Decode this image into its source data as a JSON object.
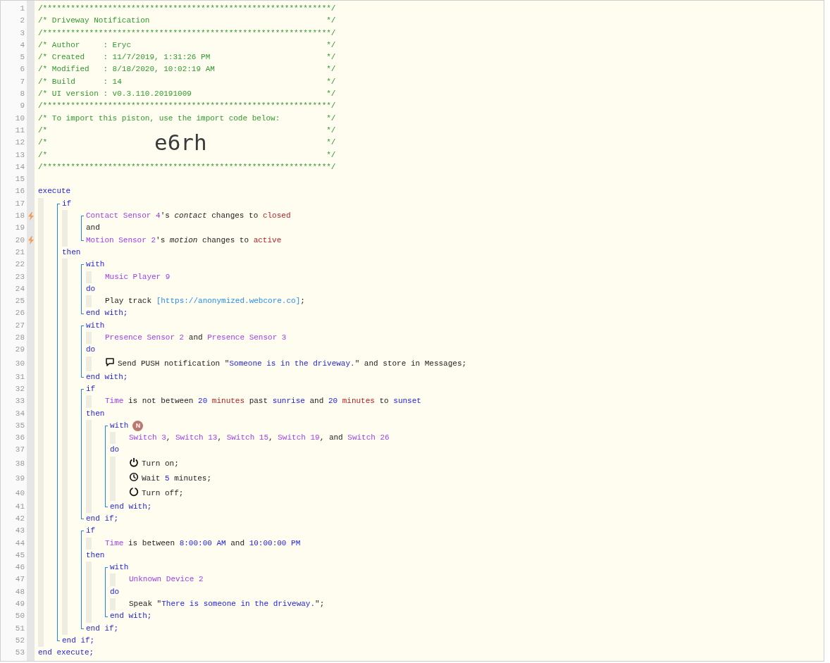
{
  "code": [
    {
      "kind": "line",
      "number": "1",
      "trigger": false,
      "segments": [
        {
          "kind": "comment",
          "text": "/**************************************************************/"
        }
      ]
    },
    {
      "kind": "line",
      "number": "2",
      "trigger": false,
      "segments": [
        {
          "kind": "comment_body",
          "text": "/* Driveway Notification"
        },
        {
          "kind": "comment",
          "text": "*/"
        }
      ]
    },
    {
      "kind": "line",
      "number": "3",
      "trigger": false,
      "segments": [
        {
          "kind": "comment",
          "text": "/**************************************************************/"
        }
      ]
    },
    {
      "kind": "line",
      "number": "4",
      "trigger": false,
      "segments": [
        {
          "kind": "comment_body",
          "text": "/* Author     : Eryc"
        },
        {
          "kind": "comment",
          "text": "*/"
        }
      ]
    },
    {
      "kind": "line",
      "number": "5",
      "trigger": false,
      "segments": [
        {
          "kind": "comment_body",
          "text": "/* Created    : 11/7/2019, 1:31:26 PM"
        },
        {
          "kind": "comment",
          "text": "*/"
        }
      ]
    },
    {
      "kind": "line",
      "number": "6",
      "trigger": false,
      "segments": [
        {
          "kind": "comment_body",
          "text": "/* Modified   : 8/18/2020, 10:02:19 AM"
        },
        {
          "kind": "comment",
          "text": "*/"
        }
      ]
    },
    {
      "kind": "line",
      "number": "7",
      "trigger": false,
      "segments": [
        {
          "kind": "comment_body",
          "text": "/* Build      : 14"
        },
        {
          "kind": "comment",
          "text": "*/"
        }
      ]
    },
    {
      "kind": "line",
      "number": "8",
      "trigger": false,
      "segments": [
        {
          "kind": "comment_body",
          "text": "/* UI version : v0.3.110.20191009"
        },
        {
          "kind": "comment",
          "text": "*/"
        }
      ]
    },
    {
      "kind": "line",
      "number": "9",
      "trigger": false,
      "segments": [
        {
          "kind": "comment",
          "text": "/**************************************************************/"
        }
      ]
    },
    {
      "kind": "line",
      "number": "10",
      "trigger": false,
      "segments": [
        {
          "kind": "comment_body",
          "text": "/* To import this piston, use the import code below:"
        },
        {
          "kind": "comment",
          "text": "*/"
        }
      ]
    },
    {
      "kind": "line",
      "number": "11",
      "trigger": false,
      "segments": [
        {
          "kind": "comment_body",
          "text": "/*"
        },
        {
          "kind": "comment",
          "text": "*/"
        }
      ]
    },
    {
      "kind": "line",
      "number": "12",
      "trigger": false,
      "segments": [
        {
          "kind": "comment_body",
          "text": "/*"
        },
        {
          "kind": "import_code",
          "text": "e6rh"
        },
        {
          "kind": "comment",
          "text": "*/"
        }
      ]
    },
    {
      "kind": "line",
      "number": "13",
      "trigger": false,
      "segments": [
        {
          "kind": "comment_body",
          "text": "/*"
        },
        {
          "kind": "comment",
          "text": "*/"
        }
      ]
    },
    {
      "kind": "line",
      "number": "14",
      "trigger": false,
      "segments": [
        {
          "kind": "comment",
          "text": "/**************************************************************/"
        }
      ]
    },
    {
      "kind": "line",
      "number": "15",
      "trigger": false
    },
    {
      "kind": "line",
      "number": "16",
      "trigger": false,
      "segments": [
        {
          "kind": "keyword",
          "text": "execute"
        }
      ]
    },
    {
      "kind": "indent",
      "children": [
        {
          "kind": "bracket",
          "children": [
            {
              "kind": "line",
              "number": "17",
              "trigger": false,
              "segments": [
                {
                  "kind": "keyword",
                  "text": "if"
                }
              ]
            },
            {
              "kind": "indent",
              "children": [
                {
                  "kind": "bracket",
                  "children": [
                    {
                      "kind": "line",
                      "number": "18",
                      "trigger": true,
                      "segments": [
                        {
                          "kind": "device",
                          "text": "Contact Sensor 4"
                        },
                        {
                          "kind": "plain",
                          "text": "'s "
                        },
                        {
                          "kind": "attribute",
                          "text": "contact"
                        },
                        {
                          "kind": "plain",
                          "text": " changes to "
                        },
                        {
                          "kind": "value",
                          "text": "closed"
                        }
                      ]
                    },
                    {
                      "kind": "line",
                      "number": "19",
                      "trigger": false,
                      "segments": [
                        {
                          "kind": "plain",
                          "text": "and"
                        }
                      ]
                    },
                    {
                      "kind": "line",
                      "number": "20",
                      "trigger": true,
                      "segments": [
                        {
                          "kind": "device",
                          "text": "Motion Sensor 2"
                        },
                        {
                          "kind": "plain",
                          "text": "'s "
                        },
                        {
                          "kind": "attribute",
                          "text": "motion"
                        },
                        {
                          "kind": "plain",
                          "text": " changes to "
                        },
                        {
                          "kind": "value",
                          "text": "active"
                        }
                      ]
                    }
                  ]
                }
              ]
            },
            {
              "kind": "line",
              "number": "21",
              "trigger": false,
              "segments": [
                {
                  "kind": "keyword",
                  "text": "then"
                }
              ]
            },
            {
              "kind": "indent",
              "children": [
                {
                  "kind": "bracket",
                  "children": [
                    {
                      "kind": "line",
                      "number": "22",
                      "trigger": false,
                      "segments": [
                        {
                          "kind": "keyword",
                          "text": "with"
                        }
                      ]
                    },
                    {
                      "kind": "indent",
                      "children": [
                        {
                          "kind": "line",
                          "number": "23",
                          "trigger": false,
                          "segments": [
                            {
                              "kind": "device",
                              "text": "Music Player 9"
                            }
                          ]
                        }
                      ]
                    },
                    {
                      "kind": "line",
                      "number": "24",
                      "trigger": false,
                      "segments": [
                        {
                          "kind": "keyword",
                          "text": "do"
                        }
                      ]
                    },
                    {
                      "kind": "indent",
                      "children": [
                        {
                          "kind": "line",
                          "number": "25",
                          "trigger": false,
                          "segments": [
                            {
                              "kind": "plain",
                              "text": "Play track "
                            },
                            {
                              "kind": "url",
                              "text": "[https://anonymized.webcore.co]"
                            },
                            {
                              "kind": "plain",
                              "text": ";"
                            }
                          ]
                        }
                      ]
                    },
                    {
                      "kind": "line",
                      "number": "26",
                      "trigger": false,
                      "segments": [
                        {
                          "kind": "keyword",
                          "text": "end with;"
                        }
                      ]
                    }
                  ]
                },
                {
                  "kind": "bracket",
                  "children": [
                    {
                      "kind": "line",
                      "number": "27",
                      "trigger": false,
                      "segments": [
                        {
                          "kind": "keyword",
                          "text": "with"
                        }
                      ]
                    },
                    {
                      "kind": "indent",
                      "children": [
                        {
                          "kind": "line",
                          "number": "28",
                          "trigger": false,
                          "segments": [
                            {
                              "kind": "device",
                              "text": "Presence Sensor 2"
                            },
                            {
                              "kind": "plain",
                              "text": " and "
                            },
                            {
                              "kind": "device",
                              "text": "Presence Sensor 3"
                            }
                          ]
                        }
                      ]
                    },
                    {
                      "kind": "line",
                      "number": "29",
                      "trigger": false,
                      "segments": [
                        {
                          "kind": "keyword",
                          "text": "do"
                        }
                      ]
                    },
                    {
                      "kind": "indent",
                      "children": [
                        {
                          "kind": "line",
                          "number": "30",
                          "trigger": false,
                          "segments": [
                            {
                              "kind": "chat"
                            },
                            {
                              "kind": "plain",
                              "text": "Send PUSH notification \""
                            },
                            {
                              "kind": "string",
                              "text": "Someone is in the driveway."
                            },
                            {
                              "kind": "plain",
                              "text": "\" and store in Messages;"
                            }
                          ]
                        }
                      ]
                    },
                    {
                      "kind": "line",
                      "number": "31",
                      "trigger": false,
                      "segments": [
                        {
                          "kind": "keyword",
                          "text": "end with;"
                        }
                      ]
                    }
                  ]
                },
                {
                  "kind": "bracket",
                  "children": [
                    {
                      "kind": "line",
                      "number": "32",
                      "trigger": false,
                      "segments": [
                        {
                          "kind": "keyword",
                          "text": "if"
                        }
                      ]
                    },
                    {
                      "kind": "indent",
                      "children": [
                        {
                          "kind": "line",
                          "number": "33",
                          "trigger": false,
                          "segments": [
                            {
                              "kind": "device",
                              "text": "Time"
                            },
                            {
                              "kind": "plain",
                              "text": " is not between "
                            },
                            {
                              "kind": "number",
                              "text": "20"
                            },
                            {
                              "kind": "value",
                              "text": " minutes"
                            },
                            {
                              "kind": "plain",
                              "text": " past "
                            },
                            {
                              "kind": "number",
                              "text": "sunrise"
                            },
                            {
                              "kind": "plain",
                              "text": " and "
                            },
                            {
                              "kind": "number",
                              "text": "20"
                            },
                            {
                              "kind": "value",
                              "text": " minutes"
                            },
                            {
                              "kind": "plain",
                              "text": " to "
                            },
                            {
                              "kind": "number",
                              "text": "sunset"
                            }
                          ]
                        }
                      ]
                    },
                    {
                      "kind": "line",
                      "number": "34",
                      "trigger": false,
                      "segments": [
                        {
                          "kind": "keyword",
                          "text": "then"
                        }
                      ]
                    },
                    {
                      "kind": "indent",
                      "children": [
                        {
                          "kind": "bracket",
                          "children": [
                            {
                              "kind": "line",
                              "number": "35",
                              "trigger": false,
                              "segments": [
                                {
                                  "kind": "keyword",
                                  "text": "with"
                                },
                                {
                                  "kind": "badge",
                                  "text": "N"
                                }
                              ]
                            },
                            {
                              "kind": "indent",
                              "children": [
                                {
                                  "kind": "line",
                                  "number": "36",
                                  "trigger": false,
                                  "segments": [
                                    {
                                      "kind": "device",
                                      "text": "Switch 3"
                                    },
                                    {
                                      "kind": "plain",
                                      "text": ", "
                                    },
                                    {
                                      "kind": "device",
                                      "text": "Switch 13"
                                    },
                                    {
                                      "kind": "plain",
                                      "text": ", "
                                    },
                                    {
                                      "kind": "device",
                                      "text": "Switch 15"
                                    },
                                    {
                                      "kind": "plain",
                                      "text": ", "
                                    },
                                    {
                                      "kind": "device",
                                      "text": "Switch 19"
                                    },
                                    {
                                      "kind": "plain",
                                      "text": ", and "
                                    },
                                    {
                                      "kind": "device",
                                      "text": "Switch 26"
                                    }
                                  ]
                                }
                              ]
                            },
                            {
                              "kind": "line",
                              "number": "37",
                              "trigger": false,
                              "segments": [
                                {
                                  "kind": "keyword",
                                  "text": "do"
                                }
                              ]
                            },
                            {
                              "kind": "indent",
                              "children": [
                                {
                                  "kind": "line",
                                  "number": "38",
                                  "trigger": false,
                                  "segments": [
                                    {
                                      "kind": "power"
                                    },
                                    {
                                      "kind": "plain",
                                      "text": "Turn on;"
                                    }
                                  ]
                                },
                                {
                                  "kind": "line",
                                  "number": "39",
                                  "trigger": false,
                                  "segments": [
                                    {
                                      "kind": "clock"
                                    },
                                    {
                                      "kind": "plain",
                                      "text": "Wait "
                                    },
                                    {
                                      "kind": "number",
                                      "text": "5"
                                    },
                                    {
                                      "kind": "plain",
                                      "text": " minutes;"
                                    }
                                  ]
                                },
                                {
                                  "kind": "line",
                                  "number": "40",
                                  "trigger": false,
                                  "segments": [
                                    {
                                      "kind": "ring"
                                    },
                                    {
                                      "kind": "plain",
                                      "text": "Turn off;"
                                    }
                                  ]
                                }
                              ]
                            },
                            {
                              "kind": "line",
                              "number": "41",
                              "trigger": false,
                              "segments": [
                                {
                                  "kind": "keyword",
                                  "text": "end with;"
                                }
                              ]
                            }
                          ]
                        }
                      ]
                    },
                    {
                      "kind": "line",
                      "number": "42",
                      "trigger": false,
                      "segments": [
                        {
                          "kind": "keyword",
                          "text": "end if;"
                        }
                      ]
                    }
                  ]
                },
                {
                  "kind": "bracket",
                  "children": [
                    {
                      "kind": "line",
                      "number": "43",
                      "trigger": false,
                      "segments": [
                        {
                          "kind": "keyword",
                          "text": "if"
                        }
                      ]
                    },
                    {
                      "kind": "indent",
                      "children": [
                        {
                          "kind": "line",
                          "number": "44",
                          "trigger": false,
                          "segments": [
                            {
                              "kind": "device",
                              "text": "Time"
                            },
                            {
                              "kind": "plain",
                              "text": " is between "
                            },
                            {
                              "kind": "number",
                              "text": "8:00:00 AM"
                            },
                            {
                              "kind": "plain",
                              "text": " and "
                            },
                            {
                              "kind": "number",
                              "text": "10:00:00 PM"
                            }
                          ]
                        }
                      ]
                    },
                    {
                      "kind": "line",
                      "number": "45",
                      "trigger": false,
                      "segments": [
                        {
                          "kind": "keyword",
                          "text": "then"
                        }
                      ]
                    },
                    {
                      "kind": "indent",
                      "children": [
                        {
                          "kind": "bracket",
                          "children": [
                            {
                              "kind": "line",
                              "number": "46",
                              "trigger": false,
                              "segments": [
                                {
                                  "kind": "keyword",
                                  "text": "with"
                                }
                              ]
                            },
                            {
                              "kind": "indent",
                              "children": [
                                {
                                  "kind": "line",
                                  "number": "47",
                                  "trigger": false,
                                  "segments": [
                                    {
                                      "kind": "device",
                                      "text": "Unknown Device 2"
                                    }
                                  ]
                                }
                              ]
                            },
                            {
                              "kind": "line",
                              "number": "48",
                              "trigger": false,
                              "segments": [
                                {
                                  "kind": "keyword",
                                  "text": "do"
                                }
                              ]
                            },
                            {
                              "kind": "indent",
                              "children": [
                                {
                                  "kind": "line",
                                  "number": "49",
                                  "trigger": false,
                                  "segments": [
                                    {
                                      "kind": "plain",
                                      "text": "Speak \""
                                    },
                                    {
                                      "kind": "string",
                                      "text": "There is someone in the driveway."
                                    },
                                    {
                                      "kind": "plain",
                                      "text": "\";"
                                    }
                                  ]
                                }
                              ]
                            },
                            {
                              "kind": "line",
                              "number": "50",
                              "trigger": false,
                              "segments": [
                                {
                                  "kind": "keyword",
                                  "text": "end with;"
                                }
                              ]
                            }
                          ]
                        }
                      ]
                    },
                    {
                      "kind": "line",
                      "number": "51",
                      "trigger": false,
                      "segments": [
                        {
                          "kind": "keyword",
                          "text": "end if;"
                        }
                      ]
                    }
                  ]
                }
              ]
            },
            {
              "kind": "line",
              "number": "52",
              "trigger": false,
              "segments": [
                {
                  "kind": "keyword",
                  "text": "end if;"
                }
              ]
            }
          ]
        }
      ]
    },
    {
      "kind": "line",
      "number": "53",
      "trigger": false,
      "segments": [
        {
          "kind": "keyword",
          "text": "end execute;"
        }
      ]
    }
  ]
}
